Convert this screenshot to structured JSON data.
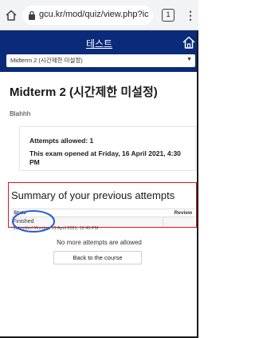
{
  "browser": {
    "url": "gcu.kr/mod/quiz/view.php?ic",
    "tab_count": "1",
    "menu_glyph": "⋮",
    "home_icon": "home-icon",
    "lock_icon": "lock-icon"
  },
  "site": {
    "title": "테스트",
    "home_icon": "home-icon",
    "course_select": {
      "selected": "Midterm 2 (시간제한 미설정)"
    }
  },
  "quiz": {
    "title": "Midterm 2 (시간제한 미설정)",
    "intro": "Blahhh",
    "attempts_allowed": "Attempts allowed: 1",
    "opened": "This exam opened at Friday, 16 April 2021, 4:30 PM"
  },
  "summary": {
    "title": "Summary of your previous attempts",
    "columns": [
      "State",
      "Review"
    ],
    "rows": [
      {
        "state": "Finished",
        "submitted": "Submitted Monday, 19 April 2021, 12:45 PM",
        "review": ""
      }
    ]
  },
  "footer": {
    "no_more": "No more attempts are allowed",
    "back_button": "Back to the course"
  },
  "colors": {
    "header_bg": "#0a2a7a",
    "highlight_box": "#e4141e",
    "annotation_circle": "#2a5bd7"
  }
}
